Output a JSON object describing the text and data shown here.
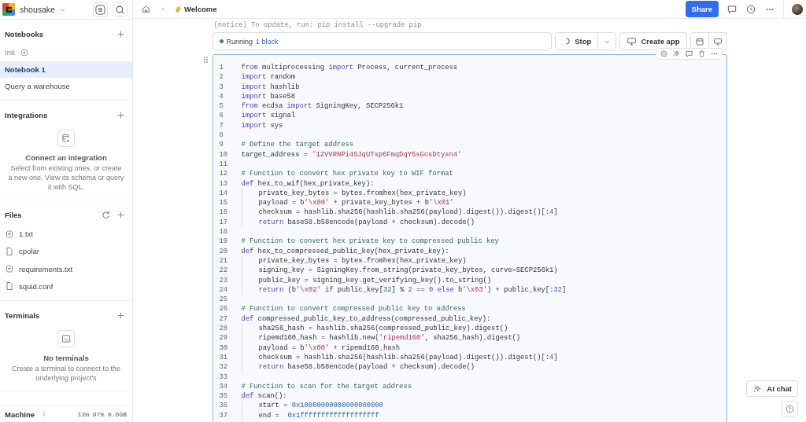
{
  "workspace": {
    "name": "shousake"
  },
  "sidebar": {
    "sections": [
      {
        "kind": "list",
        "title": "Notebooks",
        "items": [
          {
            "label": "Init",
            "selected": false,
            "kind": "init"
          },
          {
            "label": "Notebook 1",
            "selected": true
          },
          {
            "label": "Query a warehouse",
            "selected": false
          }
        ]
      },
      {
        "kind": "integrations",
        "title": "Integrations",
        "empty_title": "Connect an integration",
        "empty_text": "Select from existing ones, or create a new one. View its schema or query it with SQL."
      },
      {
        "kind": "files",
        "title": "Files",
        "items": [
          {
            "label": "1.txt",
            "kind": "text"
          },
          {
            "label": "cpolar",
            "kind": "plain"
          },
          {
            "label": "requirements.txt",
            "kind": "text"
          },
          {
            "label": "squid.conf",
            "kind": "plain"
          }
        ]
      },
      {
        "kind": "terminals",
        "title": "Terminals",
        "empty_title": "No terminals",
        "empty_text": "Create a terminal to connect to the underlying project's"
      }
    ],
    "machine": {
      "label": "Machine",
      "stats": "12m 97% 0.6GB"
    }
  },
  "breadcrumb": {
    "page": "Welcome"
  },
  "share_button": "Share",
  "output_text": "(notice) To update, run: pip install --upgrade pip",
  "run_status": {
    "label": "Running",
    "link": "1 block"
  },
  "stop_button": "Stop",
  "create_app_button": "Create app",
  "code": [
    {
      "n": "1",
      "segs": [
        {
          "kind": "keyword",
          "text": "from"
        },
        {
          "kind": "plain",
          "text": " multiprocessing "
        },
        {
          "kind": "keyword",
          "text": "import"
        },
        {
          "kind": "plain",
          "text": " Process, current_process"
        }
      ]
    },
    {
      "n": "2",
      "segs": [
        {
          "kind": "keyword",
          "text": "import"
        },
        {
          "kind": "plain",
          "text": " random"
        }
      ]
    },
    {
      "n": "3",
      "segs": [
        {
          "kind": "keyword",
          "text": "import"
        },
        {
          "kind": "plain",
          "text": " hashlib"
        }
      ]
    },
    {
      "n": "4",
      "segs": [
        {
          "kind": "keyword",
          "text": "import"
        },
        {
          "kind": "plain",
          "text": " base58"
        }
      ]
    },
    {
      "n": "5",
      "segs": [
        {
          "kind": "keyword",
          "text": "from"
        },
        {
          "kind": "plain",
          "text": " ecdsa "
        },
        {
          "kind": "keyword",
          "text": "import"
        },
        {
          "kind": "plain",
          "text": " SigningKey, SECP256k1"
        }
      ]
    },
    {
      "n": "6",
      "segs": [
        {
          "kind": "keyword",
          "text": "import"
        },
        {
          "kind": "plain",
          "text": " signal"
        }
      ]
    },
    {
      "n": "7",
      "segs": [
        {
          "kind": "keyword",
          "text": "import"
        },
        {
          "kind": "plain",
          "text": " sys"
        }
      ]
    },
    {
      "n": "8"
    },
    {
      "n": "9",
      "segs": [
        {
          "kind": "comment",
          "text": "# Define the target address"
        }
      ]
    },
    {
      "n": "10",
      "segs": [
        {
          "kind": "plain",
          "text": "target_address = "
        },
        {
          "kind": "string",
          "text": "'12VVRNPi4SJqUTsp6FmqDqY5sGosDtysn4'"
        }
      ]
    },
    {
      "n": "11"
    },
    {
      "n": "12",
      "segs": [
        {
          "kind": "comment",
          "text": "# Function to convert hex private key to WIF format"
        }
      ]
    },
    {
      "n": "13",
      "segs": [
        {
          "kind": "keyword",
          "text": "def"
        },
        {
          "kind": "plain",
          "text": " hex_to_wif(hex_private_key):"
        }
      ]
    },
    {
      "n": "14",
      "kind": "indented",
      "segs": [
        {
          "kind": "plain",
          "text": "private_key_bytes = bytes.fromhex(hex_private_key)"
        }
      ]
    },
    {
      "n": "15",
      "kind": "indented",
      "segs": [
        {
          "kind": "plain",
          "text": "payload = b"
        },
        {
          "kind": "string",
          "text": "'\\x80'"
        },
        {
          "kind": "plain",
          "text": " + private_key_bytes + b"
        },
        {
          "kind": "string",
          "text": "'\\x01'"
        }
      ]
    },
    {
      "n": "16",
      "kind": "indented",
      "segs": [
        {
          "kind": "plain",
          "text": "checksum = hashlib.sha256(hashlib.sha256(payload).digest()).digest()[:"
        },
        {
          "kind": "number",
          "text": "4"
        },
        {
          "kind": "plain",
          "text": "]"
        }
      ]
    },
    {
      "n": "17",
      "kind": "indented",
      "segs": [
        {
          "kind": "keyword",
          "text": "return"
        },
        {
          "kind": "plain",
          "text": " base58.b58encode(payload + checksum).decode()"
        }
      ]
    },
    {
      "n": "18"
    },
    {
      "n": "19",
      "segs": [
        {
          "kind": "comment",
          "text": "# Function to convert hex private key to compressed public key"
        }
      ]
    },
    {
      "n": "20",
      "segs": [
        {
          "kind": "keyword",
          "text": "def"
        },
        {
          "kind": "plain",
          "text": " hex_to_compressed_public_key(hex_private_key):"
        }
      ]
    },
    {
      "n": "21",
      "kind": "indented",
      "segs": [
        {
          "kind": "plain",
          "text": "private_key_bytes = bytes.fromhex(hex_private_key)"
        }
      ]
    },
    {
      "n": "22",
      "kind": "indented",
      "segs": [
        {
          "kind": "plain",
          "text": "signing_key = SigningKey.from_string(private_key_bytes, curve=SECP256k1)"
        }
      ]
    },
    {
      "n": "23",
      "kind": "indented",
      "segs": [
        {
          "kind": "plain",
          "text": "public_key = signing_key.get_verifying_key().to_string()"
        }
      ]
    },
    {
      "n": "24",
      "kind": "indented",
      "segs": [
        {
          "kind": "keyword",
          "text": "return"
        },
        {
          "kind": "plain",
          "text": " (b"
        },
        {
          "kind": "string",
          "text": "'\\x02'"
        },
        {
          "kind": "keyword",
          "text": " if "
        },
        {
          "kind": "plain",
          "text": "public_key["
        },
        {
          "kind": "number",
          "text": "32"
        },
        {
          "kind": "plain",
          "text": "] % "
        },
        {
          "kind": "number",
          "text": "2"
        },
        {
          "kind": "plain",
          "text": " == "
        },
        {
          "kind": "number",
          "text": "0"
        },
        {
          "kind": "keyword",
          "text": " else "
        },
        {
          "kind": "plain",
          "text": "b"
        },
        {
          "kind": "string",
          "text": "'\\x03'"
        },
        {
          "kind": "plain",
          "text": ") + public_key[:"
        },
        {
          "kind": "number",
          "text": "32"
        },
        {
          "kind": "plain",
          "text": "]"
        }
      ]
    },
    {
      "n": "25"
    },
    {
      "n": "26",
      "segs": [
        {
          "kind": "comment",
          "text": "# Function to convert compressed public key to address"
        }
      ]
    },
    {
      "n": "27",
      "segs": [
        {
          "kind": "keyword",
          "text": "def"
        },
        {
          "kind": "plain",
          "text": " compressed_public_key_to_address(compressed_public_key):"
        }
      ]
    },
    {
      "n": "28",
      "kind": "indented",
      "segs": [
        {
          "kind": "plain",
          "text": "sha256_hash = hashlib.sha256(compressed_public_key).digest()"
        }
      ]
    },
    {
      "n": "29",
      "kind": "indented",
      "segs": [
        {
          "kind": "plain",
          "text": "ripemd160_hash = hashlib.new("
        },
        {
          "kind": "string",
          "text": "'ripemd160'"
        },
        {
          "kind": "plain",
          "text": ", sha256_hash).digest()"
        }
      ]
    },
    {
      "n": "30",
      "kind": "indented",
      "segs": [
        {
          "kind": "plain",
          "text": "payload = b"
        },
        {
          "kind": "string",
          "text": "'\\x00'"
        },
        {
          "kind": "plain",
          "text": " + ripemd160_hash"
        }
      ]
    },
    {
      "n": "31",
      "kind": "indented",
      "segs": [
        {
          "kind": "plain",
          "text": "checksum = hashlib.sha256(hashlib.sha256(payload).digest()).digest()[:"
        },
        {
          "kind": "number",
          "text": "4"
        },
        {
          "kind": "plain",
          "text": "]"
        }
      ]
    },
    {
      "n": "32",
      "kind": "indented",
      "segs": [
        {
          "kind": "keyword",
          "text": "return"
        },
        {
          "kind": "plain",
          "text": " base58.b58encode(payload + checksum).decode()"
        }
      ]
    },
    {
      "n": "33"
    },
    {
      "n": "34",
      "segs": [
        {
          "kind": "comment",
          "text": "# Function to scan for the target address"
        }
      ]
    },
    {
      "n": "35",
      "segs": [
        {
          "kind": "keyword",
          "text": "def"
        },
        {
          "kind": "plain",
          "text": " scan():"
        }
      ]
    },
    {
      "n": "36",
      "kind": "indented",
      "segs": [
        {
          "kind": "plain",
          "text": "start = "
        },
        {
          "kind": "number",
          "text": "0x10000000000000000000"
        }
      ]
    },
    {
      "n": "37",
      "kind": "indented",
      "segs": [
        {
          "kind": "plain",
          "text": "end =  "
        },
        {
          "kind": "number",
          "text": "0x1fffffffffffffffffff"
        }
      ]
    }
  ],
  "ai_chat_button": "AI chat"
}
